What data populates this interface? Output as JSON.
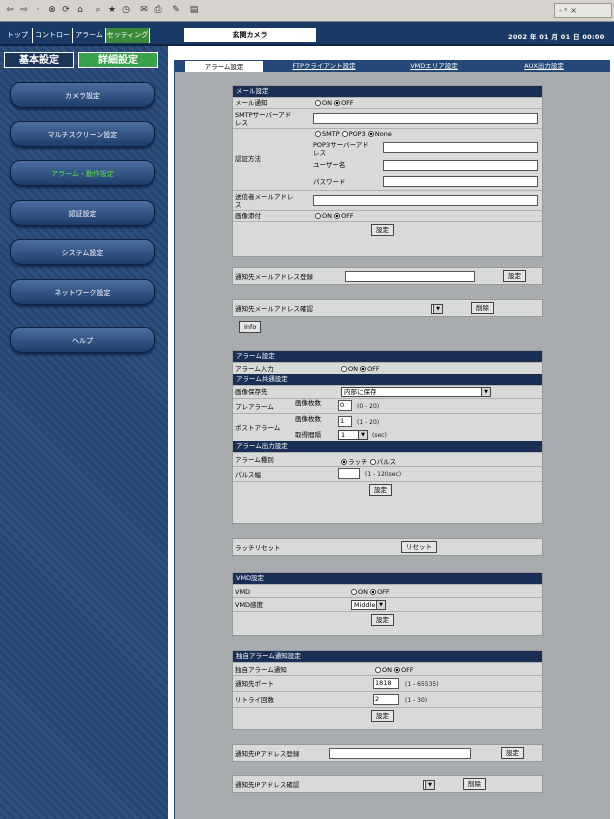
{
  "toolbar": {
    "icons": [
      "back-icon",
      "forward-icon",
      "dot-icon",
      "stop-icon",
      "refresh-icon",
      "home-icon",
      "search-icon",
      "favorites-icon",
      "history-icon",
      "mail-icon",
      "print-icon",
      "edit-icon",
      "discuss-icon"
    ],
    "window_label": "- ᵉ ×"
  },
  "nav": {
    "tabs": [
      "トップ",
      "コントロール",
      "アラーム",
      "セッティング"
    ],
    "camera_name": "玄関カメラ",
    "clock": "2002 年 01 月 01 日 00:00"
  },
  "sidebar": {
    "mode_basic": "基本設定",
    "mode_detail": "詳細設定",
    "items": [
      "カメラ設定",
      "マルチスクリーン設定",
      "アラーム・動作設定",
      "認証設定",
      "システム設定",
      "ネットワーク設定",
      "ヘルプ"
    ]
  },
  "tabs": {
    "alarm": "アラーム設定",
    "ftp": "FTPクライアント設定",
    "vmd": "VMDエリア設定",
    "aux": "AUX出力設定"
  },
  "mail": {
    "title": "メール設定",
    "notify_label": "メール通知",
    "on": "ON",
    "off": "OFF",
    "smtp_label": "SMTPサーバーアドレス",
    "auth_label": "認証方法",
    "auth_smtp": "SMTP",
    "auth_pop3": "POP3",
    "auth_none": "None",
    "pop3_label": "POP3サーバーアドレス",
    "user_label": "ユーザー名",
    "pass_label": "パスワード",
    "sender_label": "送信者メールアドレス",
    "attach_label": "画像添付",
    "set_button": "設定"
  },
  "register": {
    "label": "通知先メールアドレス登録",
    "set_button": "設定"
  },
  "confirm": {
    "label": "通知先メールアドレス確認",
    "delete_button": "削除",
    "info_button": "Info"
  },
  "alarm": {
    "title": "アラーム設定",
    "input_label": "アラーム入力",
    "on": "ON",
    "off": "OFF",
    "common_title": "アラーム共通設定",
    "save_label": "画像保存先",
    "save_value": "内部に保存",
    "pre_label": "プレアラーム",
    "post_label": "ポストアラーム",
    "count_label": "画像枚数",
    "pre_count": "0",
    "pre_range": "(0 - 20)",
    "post_count": "1",
    "post_range": "(1 - 20)",
    "interval_label": "取得間隔",
    "interval_value": "1",
    "interval_unit": "(sec)",
    "output_title": "アラーム出力設定",
    "type_label": "アラーム種別",
    "type_latch": "ラッチ",
    "type_pulse": "パルス",
    "pulse_label": "パルス幅",
    "pulse_range": "(1 - 120sec)",
    "set_button": "設定"
  },
  "latch": {
    "label": "ラッチリセット",
    "reset_button": "リセット"
  },
  "vmd": {
    "title": "VMD設定",
    "vmd_label": "VMD",
    "on": "ON",
    "off": "OFF",
    "sens_label": "VMD感度",
    "sens_value": "Middle",
    "set_button": "設定"
  },
  "custom": {
    "title": "独自アラーム通知設定",
    "notify_label": "独自アラーム通知",
    "on": "ON",
    "off": "OFF",
    "port_label": "通知先ポート",
    "port_value": "1818",
    "port_range": "(1 - 65535)",
    "retry_label": "リトライ回数",
    "retry_value": "2",
    "retry_range": "(1 - 30)",
    "set_button": "設定"
  },
  "ipreg": {
    "label": "通知先IPアドレス登録",
    "set_button": "設定"
  },
  "ipconfirm": {
    "label": "通知先IPアドレス確認",
    "delete_button": "削除"
  }
}
